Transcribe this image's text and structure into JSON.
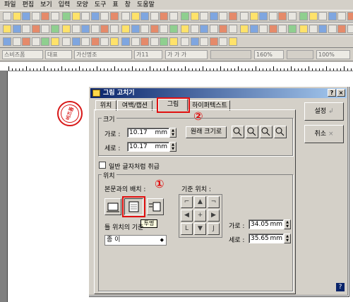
{
  "menu": [
    "파일",
    "편집",
    "보기",
    "입력",
    "모양",
    "도구",
    "표",
    "창",
    "도움말"
  ],
  "formatbar": {
    "style_name": "스비즈폼",
    "font_lang": "대표",
    "font_name": "가신명조",
    "font_size": "가11",
    "bold_italic_underline": "가 가 가",
    "zoom_left": "160%",
    "zoom_right": "100%"
  },
  "stamp": {
    "text": "비즈폼",
    "color": "#d81818"
  },
  "dialog": {
    "title": "그림 고치기",
    "help_button": "?",
    "close_button": "×",
    "tabs": [
      "위치",
      "여백/캡션",
      "그림",
      "하이퍼텍스트"
    ],
    "size_group": "크기",
    "width_label": "가로 :",
    "width_value": "10.17",
    "width_unit": "mm",
    "height_label": "세로 :",
    "height_value": "10.17",
    "height_unit": "mm",
    "original_size_button": "원래 크기로",
    "inline_checkbox_label": "일반 글자처럼 취급",
    "position_group": "위치",
    "text_wrap_label": "본문과의 배치 :",
    "position_basis_label": "틀 위치의 기준",
    "basis_value": "종 이",
    "ref_position_label": "기준 위치 :",
    "tooltip": "투명",
    "pos_x_label": "가로 :",
    "pos_x_value": "34.05",
    "pos_x_unit": "mm",
    "pos_y_label": "세로 :",
    "pos_y_value": "35.65",
    "pos_y_unit": "mm",
    "ok_button": "설정",
    "cancel_button": "취소",
    "help_corner": "?"
  },
  "annotations": {
    "circle1": "①",
    "circle2": "②",
    "color": "#e01010"
  }
}
